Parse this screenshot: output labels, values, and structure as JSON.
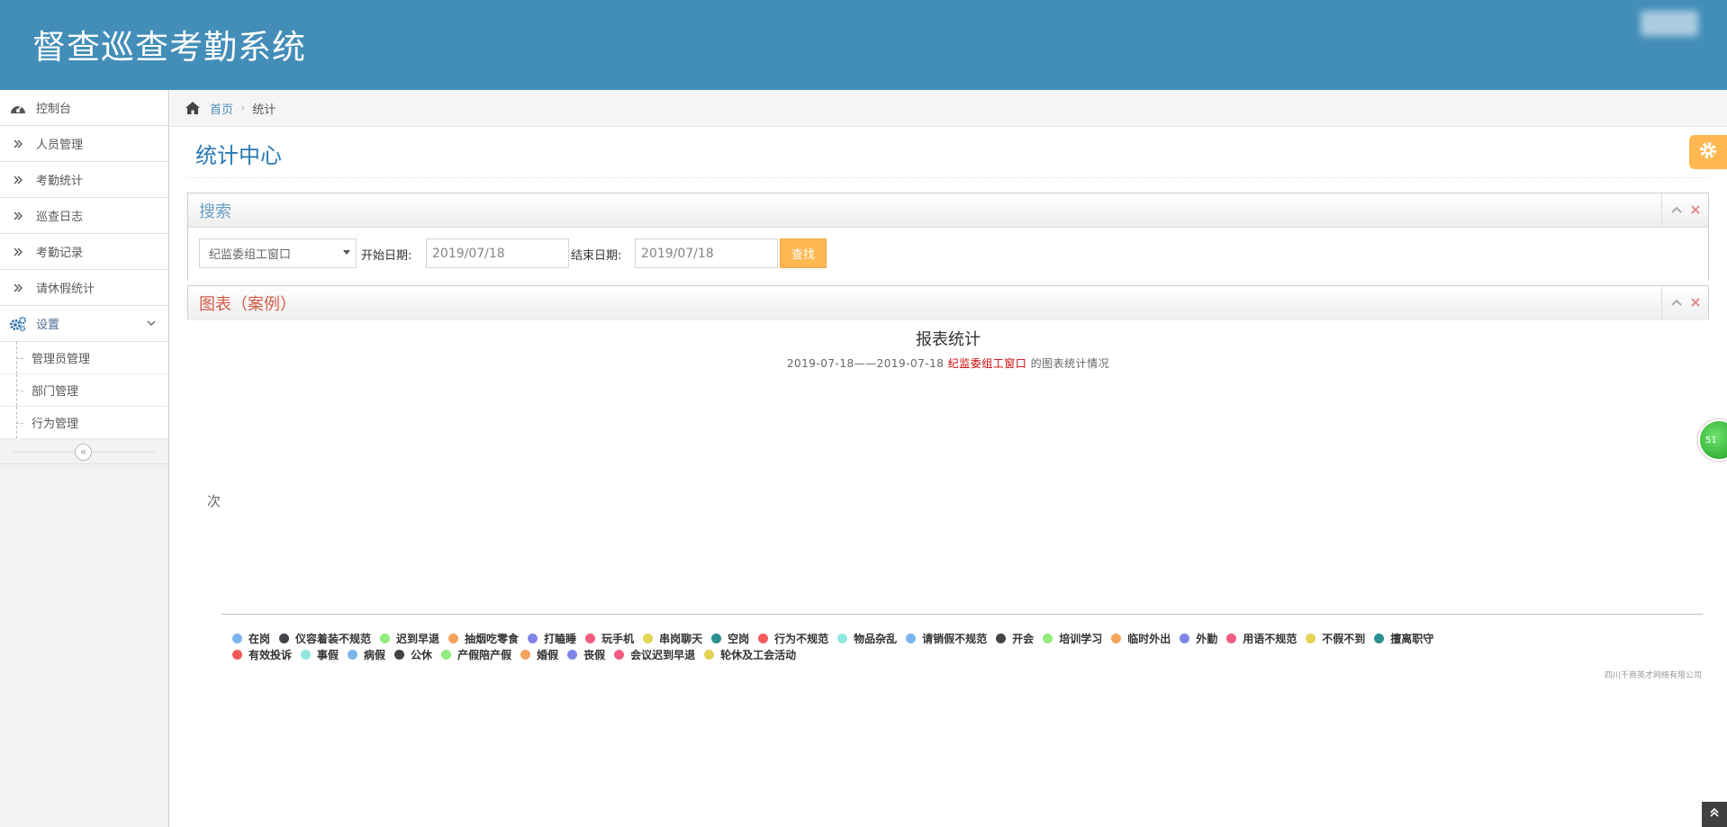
{
  "header": {
    "brand": "督查巡查考勤系统"
  },
  "sidebar": {
    "items": [
      {
        "label": "控制台",
        "icon": "dashboard-icon"
      },
      {
        "label": "人员管理",
        "icon": "double-angle-right-icon"
      },
      {
        "label": "考勤统计",
        "icon": "double-angle-right-icon"
      },
      {
        "label": "巡查日志",
        "icon": "double-angle-right-icon"
      },
      {
        "label": "考勤记录",
        "icon": "double-angle-right-icon"
      },
      {
        "label": "请休假统计",
        "icon": "double-angle-right-icon"
      }
    ],
    "settings": {
      "label": "设置",
      "icon": "cogs-icon"
    },
    "sub_items": [
      {
        "label": "管理员管理"
      },
      {
        "label": "部门管理"
      },
      {
        "label": "行为管理"
      }
    ],
    "collapse_glyph": "«"
  },
  "breadcrumb": {
    "home": "首页",
    "current": "统计",
    "separator": "›"
  },
  "page": {
    "title": "统计中心"
  },
  "search": {
    "title": "搜索",
    "department": "纪监委组工窗口",
    "start_label": "开始日期:",
    "start_value": "2019/07/18",
    "end_label": "结束日期:",
    "end_value": "2019/07/18",
    "button": "查找"
  },
  "chart_widget": {
    "title": "图表（案例）"
  },
  "colors": {
    "header_bg": "#438eb9",
    "accent_orange": "#ffb752",
    "title_blue": "#2679b5",
    "chart_title_red": "#d15b47"
  },
  "chart_data": {
    "type": "bar",
    "title": "报表统计",
    "subtitle_prefix": "2019-07-18——2019-07-18",
    "subtitle_dept": "纪监委组工窗口",
    "subtitle_suffix": "的图表统计情况",
    "ylabel": "次",
    "legend_position": "bottom",
    "series": [
      {
        "name": "在岗",
        "color": "#7cb5ec"
      },
      {
        "name": "仪容着装不规范",
        "color": "#434348"
      },
      {
        "name": "迟到早退",
        "color": "#90ed7d"
      },
      {
        "name": "抽烟吃零食",
        "color": "#f7a35c"
      },
      {
        "name": "打瞌睡",
        "color": "#8085e9"
      },
      {
        "name": "玩手机",
        "color": "#f15c80"
      },
      {
        "name": "串岗聊天",
        "color": "#e4d354"
      },
      {
        "name": "空岗",
        "color": "#2b908f"
      },
      {
        "name": "行为不规范",
        "color": "#f45b5b"
      },
      {
        "name": "物品杂乱",
        "color": "#91e8e1"
      },
      {
        "name": "请销假不规范",
        "color": "#7cb5ec"
      },
      {
        "name": "开会",
        "color": "#434348"
      },
      {
        "name": "培训学习",
        "color": "#90ed7d"
      },
      {
        "name": "临时外出",
        "color": "#f7a35c"
      },
      {
        "name": "外勤",
        "color": "#8085e9"
      },
      {
        "name": "用语不规范",
        "color": "#f15c80"
      },
      {
        "name": "不假不到",
        "color": "#e4d354"
      },
      {
        "name": "擅离职守",
        "color": "#2b908f"
      },
      {
        "name": "有效投诉",
        "color": "#f45b5b"
      },
      {
        "name": "事假",
        "color": "#91e8e1"
      },
      {
        "name": "病假",
        "color": "#7cb5ec"
      },
      {
        "name": "公休",
        "color": "#434348"
      },
      {
        "name": "产假陪产假",
        "color": "#90ed7d"
      },
      {
        "name": "婚假",
        "color": "#f7a35c"
      },
      {
        "name": "丧假",
        "color": "#8085e9"
      },
      {
        "name": "会议迟到早退",
        "color": "#f15c80"
      },
      {
        "name": "轮休及工会活动",
        "color": "#e4d354"
      }
    ],
    "legend_rows": [
      18,
      9
    ],
    "credits": "四川千商英才网络有限公司"
  },
  "float": {
    "ball_text": "51"
  }
}
